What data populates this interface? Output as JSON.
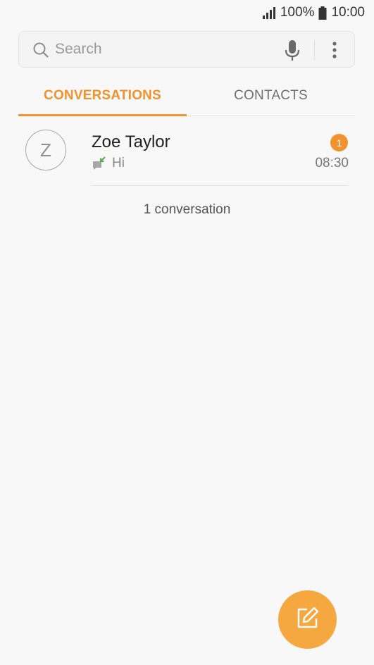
{
  "status_bar": {
    "battery_percent": "100%",
    "time": "10:00",
    "signal_icon": "signal-icon",
    "battery_icon": "battery-icon"
  },
  "search": {
    "placeholder": "Search",
    "icon": "search-icon",
    "voice_icon": "microphone-icon",
    "menu_icon": "more-options-icon"
  },
  "tabs": [
    {
      "label": "CONVERSATIONS",
      "active": true
    },
    {
      "label": "CONTACTS",
      "active": false
    }
  ],
  "conversations": [
    {
      "avatar_initial": "Z",
      "name": "Zoe Taylor",
      "preview": "Hi",
      "time": "08:30",
      "unread_count": "1",
      "direction_icon": "incoming-message-icon"
    }
  ],
  "summary": {
    "count_text": "1 conversation"
  },
  "fab": {
    "icon": "compose-icon"
  },
  "colors": {
    "accent": "#f0922e",
    "fab": "#f5a83f",
    "background": "#f8f8f8",
    "incoming_arrow": "#4caf50"
  }
}
